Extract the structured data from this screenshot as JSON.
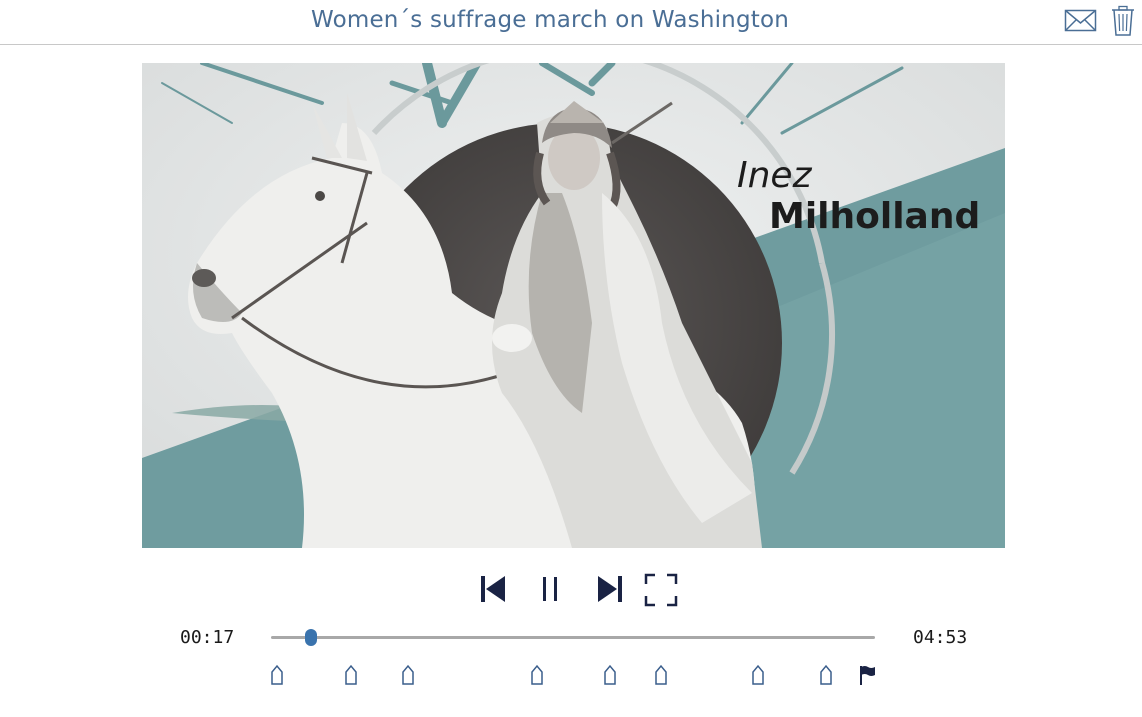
{
  "header": {
    "title": "Women´s suffrage march on Washington",
    "icons": [
      "mail-icon",
      "trash-icon"
    ]
  },
  "video": {
    "overlay_first_name": "Inez",
    "overlay_last_name": "Milholland"
  },
  "player": {
    "current_time": "00:17",
    "total_time": "04:53",
    "progress": 0.066,
    "controls": [
      "skip-back-icon",
      "pause-icon",
      "skip-forward-icon",
      "fullscreen-icon"
    ],
    "chapter_marker_count": 8,
    "bookmark": "flag-icon"
  },
  "colors": {
    "title": "#4a6e95",
    "controls": "#1a2344",
    "accent": "#3a73ad",
    "teal": "#6b999c"
  }
}
